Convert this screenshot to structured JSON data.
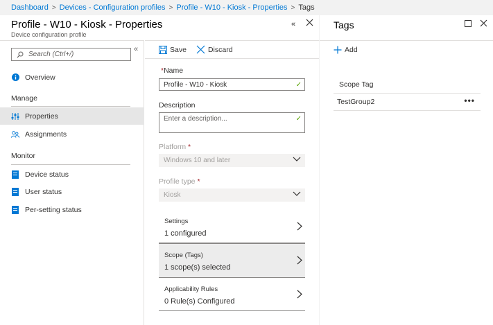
{
  "breadcrumb": {
    "items": [
      "Dashboard",
      "Devices - Configuration profiles",
      "Profile - W10 - Kiosk - Properties"
    ],
    "current": "Tags",
    "separator": ">"
  },
  "properties_blade": {
    "title": "Profile - W10 - Kiosk - Properties",
    "subtitle": "Device configuration profile",
    "collapse_glyph": "«",
    "close_glyph": "×"
  },
  "menu": {
    "search_placeholder": "Search (Ctrl+/)",
    "collapse_glyph": "«",
    "overview": "Overview",
    "groups": {
      "manage": "Manage",
      "monitor": "Monitor"
    },
    "manage_items": [
      "Properties",
      "Assignments"
    ],
    "monitor_items": [
      "Device status",
      "User status",
      "Per-setting status"
    ],
    "active_item": "Properties"
  },
  "toolbar": {
    "save_label": "Save",
    "discard_label": "Discard"
  },
  "form": {
    "required_mark": "*",
    "name_label": "Name",
    "name_value": "Profile - W10 - Kiosk",
    "description_label": "Description",
    "description_placeholder": "Enter a description...",
    "platform_label": "Platform",
    "platform_value": "Windows 10 and later",
    "profile_type_label": "Profile type",
    "profile_type_value": "Kiosk",
    "check_glyph": "✓"
  },
  "sections": [
    {
      "title": "Settings",
      "value": "1 configured"
    },
    {
      "title": "Scope (Tags)",
      "value": "1 scope(s) selected"
    },
    {
      "title": "Applicability Rules",
      "value": "0 Rule(s) Configured"
    }
  ],
  "tags_blade": {
    "title": "Tags",
    "add_label": "Add",
    "column_header": "Scope Tag",
    "rows": [
      {
        "name": "TestGroup2",
        "more": "•••"
      }
    ]
  },
  "colors": {
    "accent": "#0078d4",
    "required": "#a4262c",
    "valid_check": "#57a300",
    "selected_bg": "#ececec"
  }
}
